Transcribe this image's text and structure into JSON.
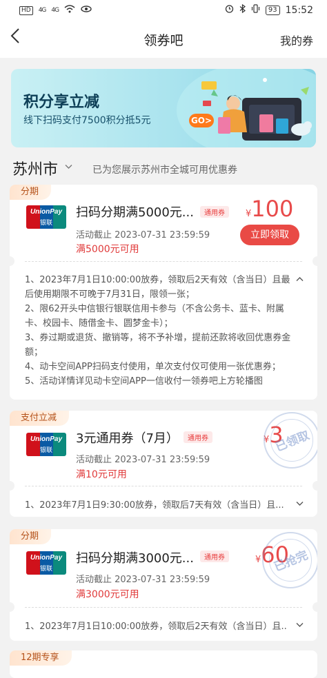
{
  "status_bar": {
    "left": "HD",
    "signal1": "4G",
    "signal2": "4G",
    "battery": "93",
    "time": "15:52"
  },
  "nav": {
    "back": "<",
    "title": "领券吧",
    "my": "我的券"
  },
  "banner": {
    "title": "积分享立减",
    "subtitle": "线下扫码支付7500积分抵5元",
    "go": "GO>"
  },
  "city": {
    "name": "苏州市",
    "tip": "已为您展示苏州市全城可用优惠券"
  },
  "coupons": [
    {
      "tag": "分期",
      "title": "扫码分期满5000元...",
      "badge": "通用券",
      "deadline": "活动截止 2023-07-31 23:59:59",
      "min": "满5000元可用",
      "currency": "¥",
      "amount": "100",
      "button": "立即领取",
      "toggle": "^",
      "rules": [
        "1、2023年7月1日10:00:00放券，领取后2天有效（含当日）且最后使用期限不可晚于7月31日，限领一张；",
        "2、限62开头中信银行银联信用卡参与（不含公务卡、蓝卡、附属卡、校园卡、随借金卡、圆梦金卡）；",
        "3、券过期或退货、撤销等，将不予补增，提前还款将收回优惠券金额；",
        "4、动卡空间APP扫码支付使用，单次支付仅可使用一张优惠券；",
        "5、活动详情详见动卡空间APP一信收付一领券吧上方轮播图"
      ]
    },
    {
      "tag": "支付立减",
      "title": "3元通用券（7月）",
      "badge": "通用券",
      "deadline": "活动截止 2023-07-31 23:59:59",
      "min": "满10元可用",
      "currency": "¥",
      "amount": "3",
      "stamp": "已领取",
      "rule": "1、2023年7月1日9:30:00放券，领取后7天有效（含当日）且...",
      "toggle": "v"
    },
    {
      "tag": "分期",
      "title": "扫码分期满3000元...",
      "badge": "通用券",
      "deadline": "活动截止 2023-07-31 23:59:59",
      "min": "满3000元可用",
      "currency": "¥",
      "amount": "60",
      "stamp": "已抢完",
      "rule": "1、2023年7月1日10:00:00放券，领取后2天有效（含当日）且...",
      "toggle": "v"
    },
    {
      "tag": "12期专享"
    }
  ],
  "unionpay": {
    "latin": "UnionPay",
    "cn": "银联"
  },
  "colors": {
    "accent": "#e94a45",
    "banner": "#a9e3ee",
    "tag_bg": "#ffe4cf"
  }
}
